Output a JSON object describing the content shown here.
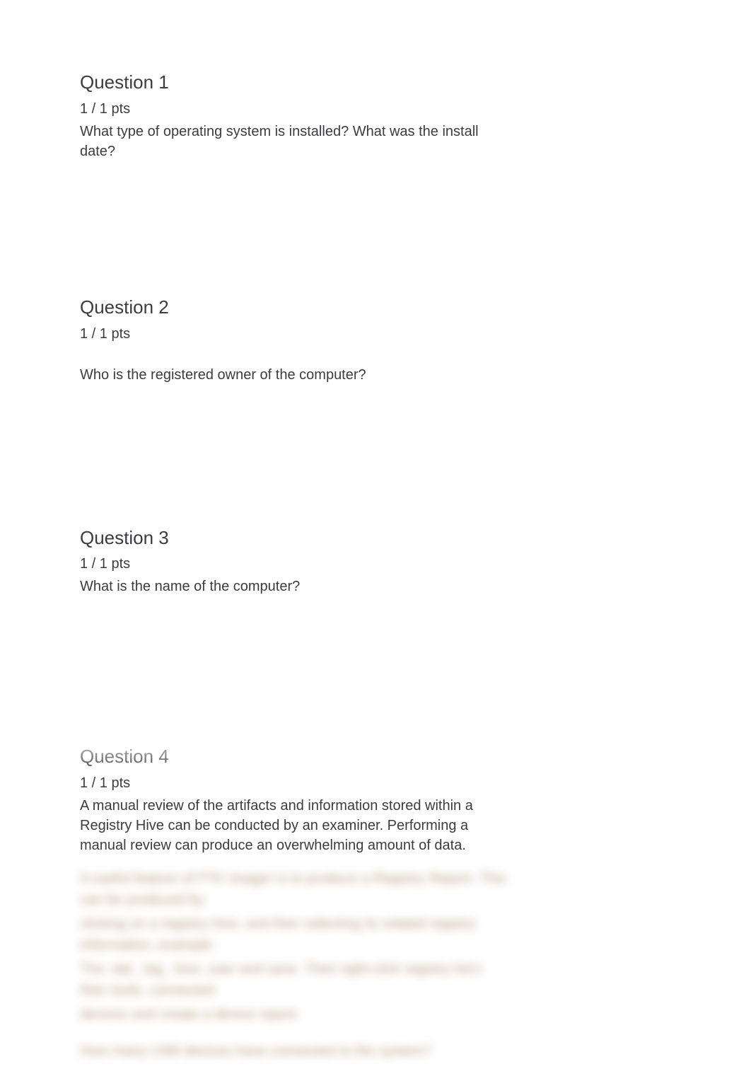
{
  "questions": [
    {
      "title": "Question 1",
      "points": "1 / 1 pts",
      "text": "What type of operating system is installed? What was the install date?"
    },
    {
      "title": "Question 2",
      "points": "1 / 1 pts",
      "text": "Who is the registered owner of the computer?"
    },
    {
      "title": "Question 3",
      "points": "1 / 1 pts",
      "text": "What is the name of the computer?"
    },
    {
      "title": "Question 4",
      "points": "1 / 1 pts",
      "text": "A manual review of the artifacts and information stored within a Registry Hive can be conducted by an examiner. Performing a manual review can produce an overwhelming amount of data."
    }
  ],
  "blurred": {
    "line1": "A useful feature of FTK Imager is to produce a Registry Report. This can be produced by",
    "line2": "clicking on a registry hive, and then selecting its related registry information, example:",
    "line3": "The .dat, .log, .hive, user and save. Then right-click registry list's then tools, connected",
    "line4": "devices and create a device report.",
    "question": "How many USB devices have connected to the system?"
  }
}
